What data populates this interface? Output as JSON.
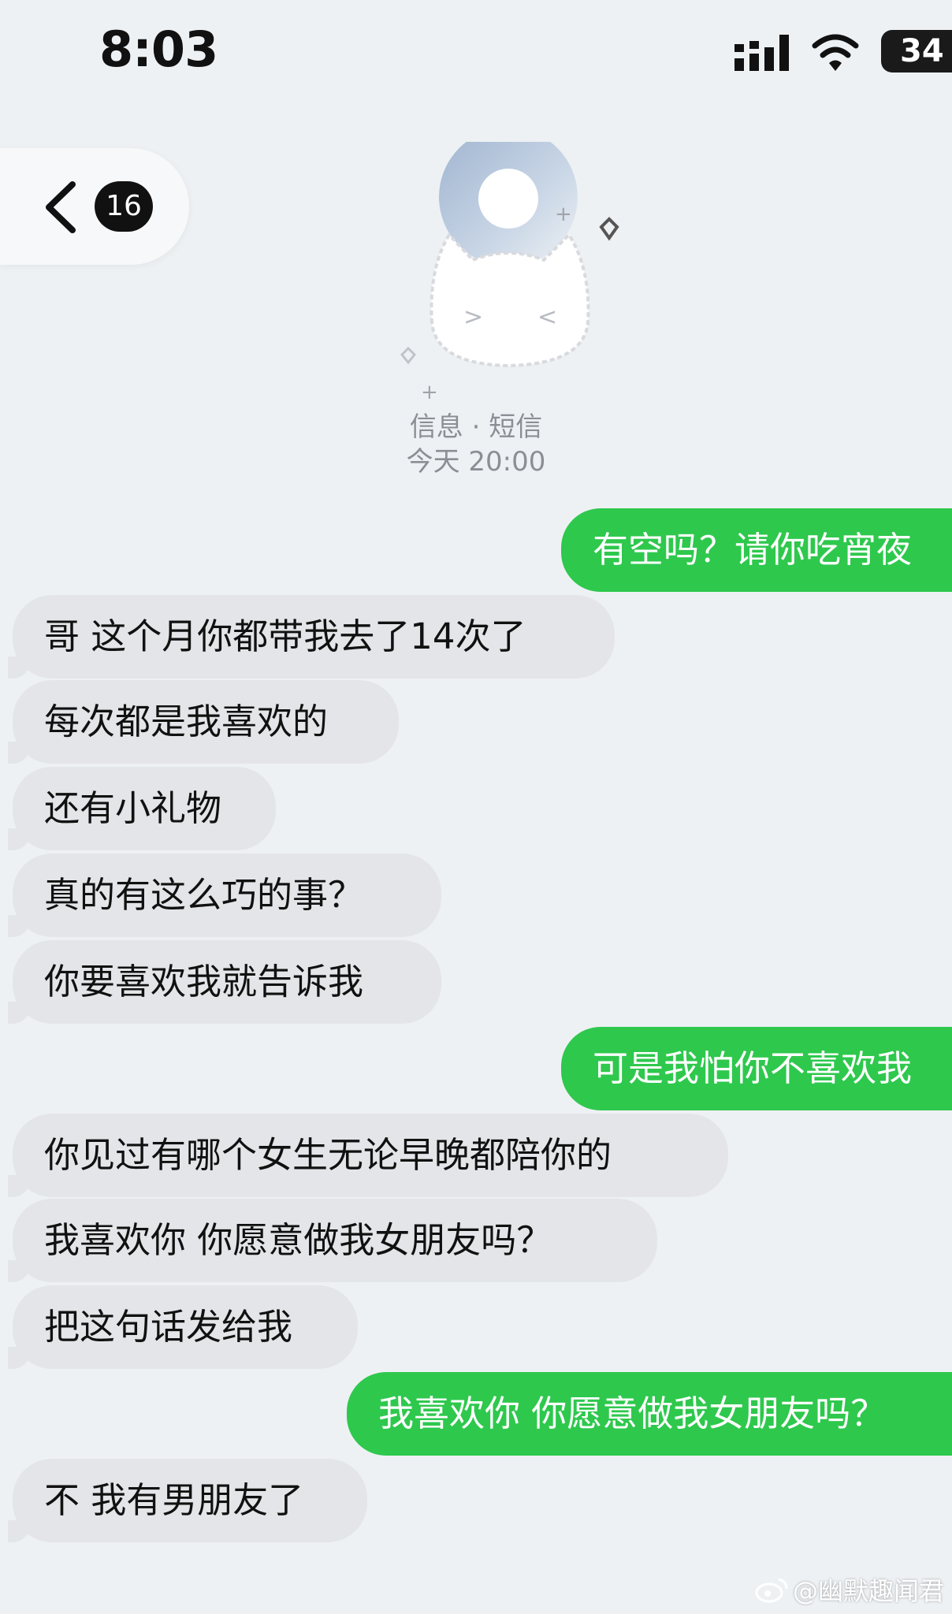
{
  "status_bar": {
    "time": "8:03",
    "battery": "34"
  },
  "header": {
    "unread_count": "16",
    "conversation_type": "信息 · 短信",
    "timestamp": "今天 20:00"
  },
  "messages": [
    {
      "direction": "outgoing",
      "text": "有空吗？请你吃宵夜"
    },
    {
      "direction": "incoming",
      "text": "哥 这个月你都带我去了14次了"
    },
    {
      "direction": "incoming",
      "text": "每次都是我喜欢的"
    },
    {
      "direction": "incoming",
      "text": "还有小礼物"
    },
    {
      "direction": "incoming",
      "text": "真的有这么巧的事？"
    },
    {
      "direction": "incoming",
      "text": "你要喜欢我就告诉我"
    },
    {
      "direction": "outgoing",
      "text": "可是我怕你不喜欢我"
    },
    {
      "direction": "incoming",
      "text": "你见过有哪个女生无论早晚都陪你的"
    },
    {
      "direction": "incoming",
      "text": "我喜欢你 你愿意做我女朋友吗？"
    },
    {
      "direction": "incoming",
      "text": "把这句话发给我"
    },
    {
      "direction": "outgoing",
      "text": "我喜欢你 你愿意做我女朋友吗？"
    },
    {
      "direction": "incoming",
      "text": "不 我有男朋友了"
    }
  ],
  "watermark": "@幽默趣闻君",
  "colors": {
    "outgoing_bubble": "#2ec84d",
    "incoming_bubble": "#e4e5e8",
    "background": "#eef1f4"
  }
}
